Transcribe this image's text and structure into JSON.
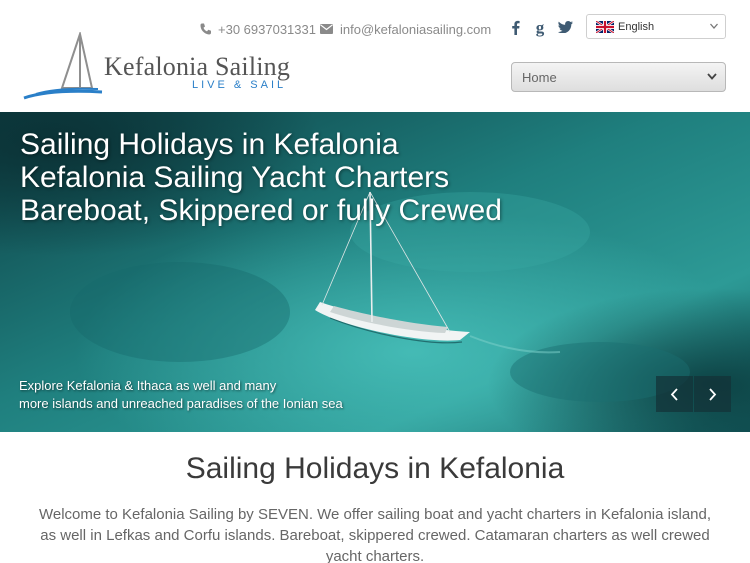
{
  "brand": {
    "name": "Kefalonia Sailing",
    "tagline": "LIVE & SAIL"
  },
  "contact": {
    "phone": "+30 6937031331",
    "email": "info@kefaloniasailing.com"
  },
  "social": {
    "facebook_icon": "facebook-icon",
    "google_icon": "google-plus-icon",
    "twitter_icon": "twitter-icon"
  },
  "language": {
    "selected": "English",
    "flag_icon": "uk-flag-icon"
  },
  "nav": {
    "selected": "Home"
  },
  "hero": {
    "title_lines": [
      "Sailing Holidays in Kefalonia",
      "Kefalonia Sailing Yacht Charters",
      "Bareboat, Skippered or fully Crewed"
    ],
    "caption_lines": [
      "Explore Kefalonia & Ithaca as well and many",
      "more islands and unreached paradises of the Ionian sea"
    ],
    "prev_icon": "chevron-left-icon",
    "next_icon": "chevron-right-icon"
  },
  "main": {
    "heading": "Sailing Holidays in Kefalonia",
    "intro": "Welcome to Kefalonia Sailing by SEVEN. We offer sailing boat and yacht charters in Kefalonia island, as well in Lefkas and Corfu islands. Bareboat, skippered crewed. Catamaran charters as well crewed yacht charters."
  },
  "colors": {
    "accent_blue": "#2a7fc8",
    "sea_dark": "#0b4a4a",
    "sea_light": "#3fb3b0",
    "text_gray": "#666666"
  }
}
